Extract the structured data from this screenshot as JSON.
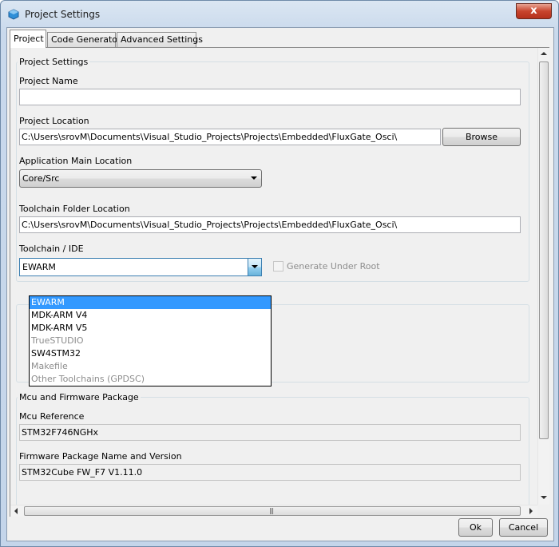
{
  "window": {
    "title": "Project Settings",
    "close_label": "x"
  },
  "tabs": [
    {
      "label": "Project"
    },
    {
      "label": "Code Generator"
    },
    {
      "label": "Advanced Settings"
    }
  ],
  "project_settings": {
    "group_title": "Project Settings",
    "project_name_label": "Project Name",
    "project_name_value": "",
    "project_location_label": "Project Location",
    "project_location_value": "C:\\Users\\srovM\\Documents\\Visual_Studio_Projects\\Projects\\Embedded\\FluxGate_Osci\\",
    "browse_label": "Browse",
    "app_main_location_label": "Application Main Location",
    "app_main_location_value": "Core/Src",
    "toolchain_folder_label": "Toolchain Folder Location",
    "toolchain_folder_value": "C:\\Users\\srovM\\Documents\\Visual_Studio_Projects\\Projects\\Embedded\\FluxGate_Osci\\",
    "toolchain_ide_label": "Toolchain / IDE",
    "toolchain_ide_value": "EWARM",
    "generate_under_root_label": "Generate Under Root",
    "generate_under_root_checked": false
  },
  "toolchain_dropdown": {
    "items": [
      {
        "label": "EWARM",
        "state": "selected"
      },
      {
        "label": "MDK-ARM V4",
        "state": "enabled"
      },
      {
        "label": "MDK-ARM V5",
        "state": "enabled"
      },
      {
        "label": "TrueSTUDIO",
        "state": "disabled"
      },
      {
        "label": "SW4STM32",
        "state": "enabled"
      },
      {
        "label": "Makefile",
        "state": "disabled"
      },
      {
        "label": "Other Toolchains (GPDSC)",
        "state": "disabled"
      }
    ]
  },
  "mcu_firmware": {
    "group_title": "Mcu and Firmware Package",
    "mcu_reference_label": "Mcu Reference",
    "mcu_reference_value": "STM32F746NGHx",
    "firmware_label": "Firmware Package Name and Version",
    "firmware_value": "STM32Cube FW_F7 V1.11.0"
  },
  "footer": {
    "ok_label": "Ok",
    "cancel_label": "Cancel"
  },
  "colors": {
    "selection": "#3399ff",
    "close_button": "#c8442d",
    "title_bar": "#c9d9ec"
  }
}
